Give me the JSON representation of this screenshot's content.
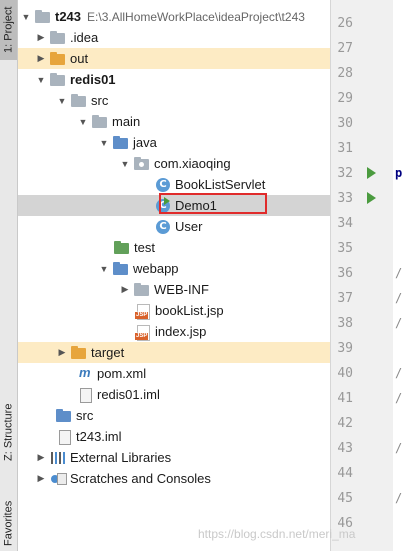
{
  "sidebar_tabs": {
    "project": "1: Project",
    "structure": "Z: Structure",
    "favorites": "Favorites"
  },
  "tree": {
    "root": {
      "label": "t243",
      "path": "E:\\3.AllHomeWorkPlace\\ideaProject\\t243"
    },
    "idea": ".idea",
    "out": "out",
    "redis01": "redis01",
    "src": "src",
    "main": "main",
    "java": "java",
    "package": "com.xiaoqing",
    "classes": [
      "BookListServlet",
      "Demo1",
      "User"
    ],
    "test": "test",
    "webapp": "webapp",
    "webinf": "WEB-INF",
    "jsp_files": [
      "bookList.jsp",
      "index.jsp"
    ],
    "target": "target",
    "pom": "pom.xml",
    "iml": "redis01.iml",
    "src2": "src",
    "t243iml": "t243.iml",
    "external": "External Libraries",
    "scratches": "Scratches and Consoles"
  },
  "gutter": {
    "line_numbers": [
      "26",
      "27",
      "28",
      "29",
      "30",
      "31",
      "32",
      "33",
      "34",
      "35",
      "36",
      "37",
      "38",
      "39",
      "40",
      "41",
      "42",
      "43",
      "44",
      "45",
      "46"
    ]
  },
  "editor_fragments": [
    "p",
    "/",
    "/",
    "/",
    "/",
    "/",
    "/",
    "/"
  ],
  "watermark": "https://blog.csdn.net/meri_ma",
  "colors": {
    "selection": "#d4d4d4",
    "highlight_box": "#e02b2b",
    "excluded_folder": "#e7a53c"
  }
}
